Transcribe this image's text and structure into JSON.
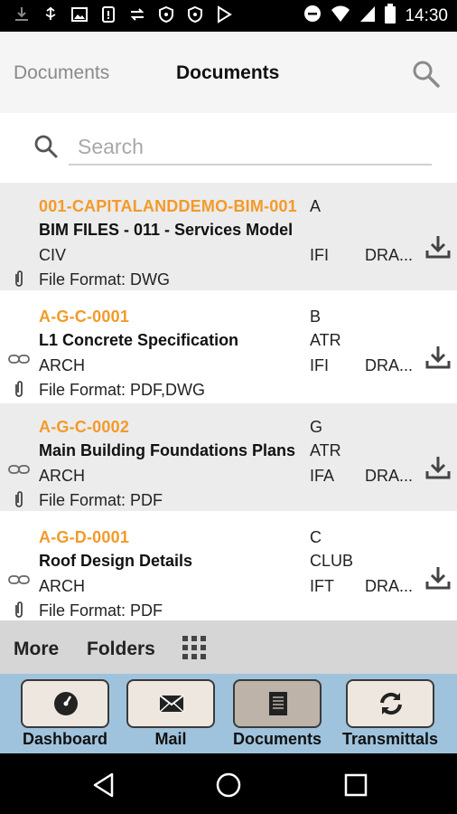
{
  "status_bar": {
    "time": "14:30",
    "icons": [
      "download-icon",
      "usb-icon",
      "image-icon",
      "sim-icon",
      "sync-icon",
      "shield-icon",
      "shield-icon",
      "play-store-icon"
    ],
    "right_icons": [
      "do-not-disturb-icon",
      "wifi-icon",
      "signal-icon",
      "battery-icon"
    ]
  },
  "header": {
    "back_label": "Documents",
    "title": "Documents",
    "search_icon": "search-icon"
  },
  "search": {
    "placeholder": "Search",
    "value": ""
  },
  "documents": [
    {
      "number": "001-CAPITALANDDEMO-BIM-001",
      "name": "BIM FILES - 011 - Services Model",
      "discipline": "CIV",
      "format": "File Format: DWG",
      "revision": "A",
      "status": "",
      "reason": "IFI",
      "state": "DRA...",
      "has_link": false
    },
    {
      "number": "A-G-C-0001",
      "name": "L1 Concrete Specification",
      "discipline": "ARCH",
      "format": "File Format: PDF,DWG",
      "revision": "B",
      "status": "ATR",
      "reason": "IFI",
      "state": "DRA...",
      "has_link": true
    },
    {
      "number": "A-G-C-0002",
      "name": "Main Building Foundations Plans",
      "discipline": "ARCH",
      "format": "File Format: PDF",
      "revision": "G",
      "status": "ATR",
      "reason": "IFA",
      "state": "DRA...",
      "has_link": true
    },
    {
      "number": "A-G-D-0001",
      "name": "Roof Design Details",
      "discipline": "ARCH",
      "format": "File Format: PDF",
      "revision": "C",
      "status": "CLUB",
      "reason": "IFT",
      "state": "DRA...",
      "has_link": true
    }
  ],
  "more_bar": {
    "more_label": "More",
    "folders_label": "Folders",
    "grid_icon": "grid-icon"
  },
  "tabs": [
    {
      "label": "Dashboard",
      "icon": "dashboard-icon",
      "active": false
    },
    {
      "label": "Mail",
      "icon": "mail-icon",
      "active": false
    },
    {
      "label": "Documents",
      "icon": "documents-icon",
      "active": true
    },
    {
      "label": "Transmittals",
      "icon": "transmittals-icon",
      "active": false
    }
  ],
  "colors": {
    "accent": "#f39a2a",
    "tabbar": "#9fc3dd",
    "row_alt": "#ececec",
    "more_bar": "#d6d6d6"
  }
}
